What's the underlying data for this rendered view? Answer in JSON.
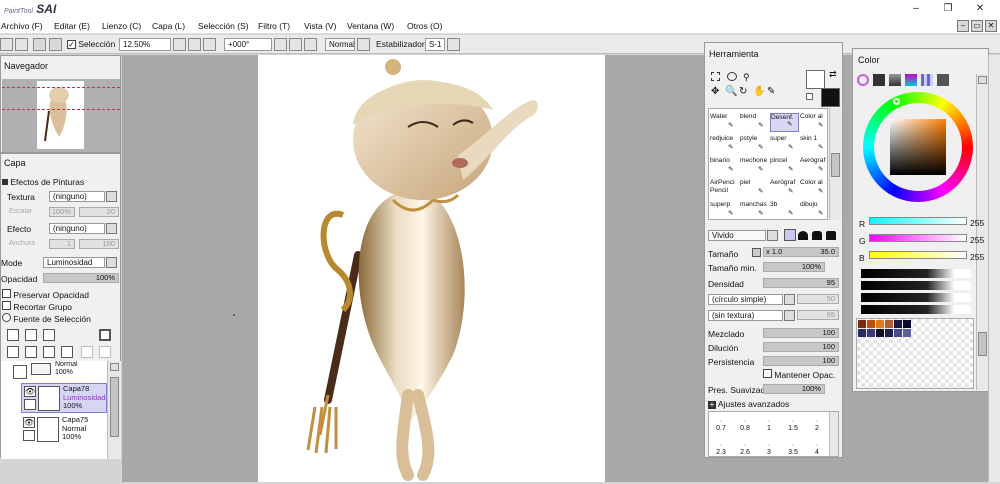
{
  "app": {
    "logo_sub": "PaintTool",
    "logo_main": "SAI",
    "minimize": "–",
    "maximize": "❐",
    "close": "✕"
  },
  "menu": [
    "Archivo (F)",
    "Editar (E)",
    "Lienzo (C)",
    "Capa (L)",
    "Selección (S)",
    "Filtro (T)",
    "Vista (V)",
    "Ventana (W)",
    "Otros (O)"
  ],
  "toolbar": {
    "selection_label": "Selección",
    "zoom": "12.50%",
    "angle": "+000°",
    "blend": "Normal",
    "stabilizer_label": "Estabilizador",
    "stabilizer_value": "S-1"
  },
  "navigator": {
    "title": "Navegador"
  },
  "layer_panel": {
    "title": "Capa",
    "effects_title": "Efectos de Pinturas",
    "texture_label": "Textura",
    "texture_value": "(ninguno)",
    "scale_label": "Escalar",
    "scale_value": "100%",
    "scale_num": "20",
    "effect_label": "Efecto",
    "effect_value": "(ninguno)",
    "width_label": "Anchura",
    "width_value": "1",
    "width_num": "100",
    "mode_label": "Mode",
    "mode_value": "Luminosidad",
    "opacity_label": "Opacidad",
    "opacity_value": "100%",
    "preserve": "Preservar Opacidad",
    "clip": "Recortar Grupo",
    "source": "Fuente de Selección",
    "layers": [
      {
        "name": "",
        "mode": "Normal",
        "opacity": "100%"
      },
      {
        "name": "Capa78",
        "mode": "Luminosidad",
        "opacity": "100%"
      },
      {
        "name": "Capa75",
        "mode": "Normal",
        "opacity": "100%"
      }
    ]
  },
  "tool_panel": {
    "title": "Herramienta",
    "brushes": [
      [
        "Water",
        "blend",
        "Desenf.",
        "Color al"
      ],
      [
        "redjuice",
        "pstyle",
        "super",
        "skin 1"
      ],
      [
        "binario",
        "mechone",
        "pincel",
        "Aerógraf"
      ],
      [
        "AirPencil Pencil",
        "piel",
        "Aerógraf",
        "Color al"
      ],
      [
        "superp",
        "manchas",
        "3b",
        "dibujo"
      ]
    ],
    "blend_mode": "Vivido",
    "size_label": "Tamaño",
    "size_mult": "x 1.0",
    "size_value": "35.0",
    "minsize_label": "Tamaño min.",
    "minsize_value": "100%",
    "density_label": "Densidad",
    "density_value": "95",
    "shape_value": "(círculo simple)",
    "shape_num": "50",
    "texture_value": "(sin textura)",
    "texture_num": "95",
    "mix_label": "Mezclado",
    "mix_value": "100",
    "dilution_label": "Dilución",
    "dilution_value": "100",
    "persistence_label": "Persistencia",
    "persistence_value": "100",
    "keep_opacity": "Mantener Opac.",
    "smooth_label": "Pres. Suavizado",
    "smooth_value": "100%",
    "advanced": "Ajustes avanzados",
    "sizes_row1": [
      "0.7",
      "0.8",
      "1",
      "1.5",
      "2"
    ],
    "sizes_row2": [
      "2.3",
      "2.6",
      "3",
      "3.5",
      "4"
    ]
  },
  "color_panel": {
    "title": "Color",
    "r_label": "R",
    "r_value": "255",
    "g_label": "G",
    "g_value": "255",
    "b_label": "B",
    "b_value": "255",
    "palette": [
      "#7a2a10",
      "#c05010",
      "#e07820",
      "#b06030",
      "#1a1a40",
      "#0a0a30",
      "#2a2a60",
      "#3a3a80",
      "#101020",
      "#202050",
      "#4a4a8a",
      "#6060a0"
    ]
  }
}
